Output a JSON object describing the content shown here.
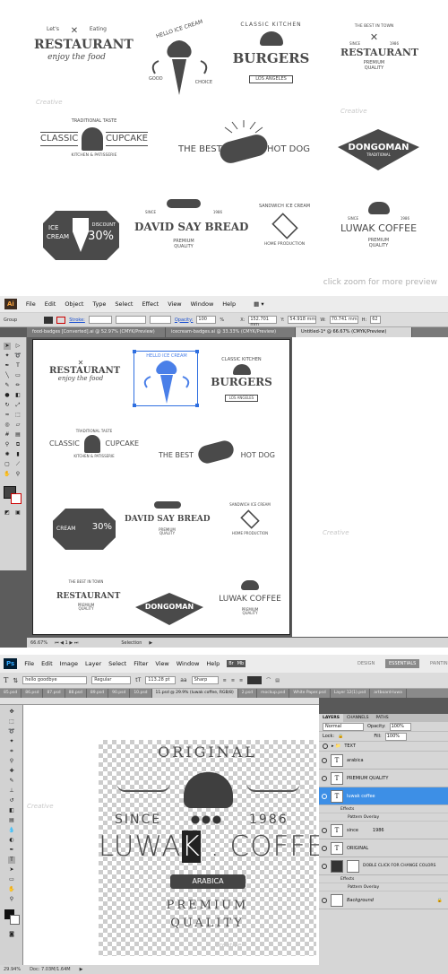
{
  "preview": {
    "caption": "click zoom for more preview",
    "badges": {
      "restaurant": {
        "top": "Let's",
        "top2": "Eating",
        "main": "RESTAURANT",
        "sub": "enjoy the food"
      },
      "icecream": {
        "arc": "HELLO ICE CREAM",
        "left": "GOOD",
        "right": "CHOICE"
      },
      "burgers": {
        "arc": "CLASSIC KITCHEN",
        "main": "BURGERS",
        "sub": "LOS ANGELES"
      },
      "restaurant2": {
        "top": "THE BEST IN TOWN",
        "since": "SINCE",
        "year": "1986",
        "main": "RESTAURANT",
        "sub1": "PREMIUM",
        "sub2": "QUALITY"
      },
      "cupcake": {
        "top": "TRADITIONAL TASTE",
        "left": "CLASSIC",
        "right": "CUPCAKE",
        "sub": "KITCHEN & PATISSERIE"
      },
      "hotdog": {
        "left": "THE BEST",
        "right": "HOT DOG"
      },
      "dongoman": {
        "main": "DONGOMAN",
        "sub": "TRADITIONAL"
      },
      "icecream2": {
        "left1": "ICE",
        "left2": "CREAM",
        "right1": "DISCOUNT",
        "right2": "30%"
      },
      "bread": {
        "since": "SINCE",
        "year": "1986",
        "main": "DAVID SAY BREAD",
        "sub1": "PREMIUM",
        "sub2": "QUALITY"
      },
      "sandwich": {
        "arc": "SANDWICH ICE CREAM",
        "sub": "HOME PRODUCTION"
      },
      "coffee": {
        "top": "ORIGINAL",
        "since": "SINCE",
        "year": "1986",
        "main": "LUWAK COFFEE",
        "sub1": "PREMIUM",
        "sub2": "QUALITY"
      }
    }
  },
  "illustrator": {
    "app_icon": "Ai",
    "menu": [
      "File",
      "Edit",
      "Object",
      "Type",
      "Select",
      "Effect",
      "View",
      "Window",
      "Help"
    ],
    "control": {
      "group": "Group",
      "stroke": "Stroke:",
      "opacity_label": "Opacity:",
      "opacity": "100",
      "pct": "%",
      "x_label": "X:",
      "x": "152.701 mm",
      "y_label": "Y:",
      "y": "54.918 mm",
      "w_label": "W:",
      "w": "70.741 mm",
      "h_label": "H:",
      "h": "62"
    },
    "tabs": [
      "food-badges [Converted].ai @ 52.97% (CMYK/Preview)",
      "icecream-badges.ai @ 33.33% (CMYK/Preview)",
      "Untitled-1* @ 66.67% (CMYK/Preview)"
    ],
    "status": {
      "zoom": "66.67%",
      "page": "1",
      "tool": "Selection"
    }
  },
  "photoshop": {
    "app_icon": "Ps",
    "menu": [
      "File",
      "Edit",
      "Image",
      "Layer",
      "Select",
      "Filter",
      "View",
      "Window",
      "Help"
    ],
    "workspaces": [
      "DESIGN",
      "ESSENTIALS",
      "PAINTIN"
    ],
    "options": {
      "font": "hello goodbye",
      "style": "Regular",
      "size": "113.28 pt",
      "aa": "Sharp"
    },
    "tabs": [
      "85.psd",
      "86.psd",
      "87.psd",
      "88.psd",
      "89.psd",
      "90.psd",
      "10.psd",
      "11.psd @ 29.9% (luwak coffee, RGB/8)",
      "2.psd",
      "mockup.psd",
      "White Paper.psd",
      "Layer 12(1).psd",
      "artboard-luwa"
    ],
    "status": {
      "zoom": "29.94%",
      "doc": "Doc: 7.03M/1.64M"
    },
    "layers_panel": {
      "tabs": [
        "LAYERS",
        "CHANNELS",
        "PATHS"
      ],
      "blend": "Normal",
      "opacity_label": "Opacity:",
      "opacity": "100%",
      "lock_label": "Lock:",
      "fill_label": "Fill:",
      "fill": "100%",
      "group": "TEXT",
      "layers": [
        {
          "name": "arabica",
          "type": "text"
        },
        {
          "name": "PREMIUM QUALITY",
          "type": "text"
        },
        {
          "name": "luwak coffee",
          "type": "text",
          "selected": true
        },
        {
          "name": "since          1986",
          "type": "text"
        },
        {
          "name": "ORIGINAL",
          "type": "text"
        },
        {
          "name": "DOBLE CLICK FOR CHANGE COLORS",
          "type": "image"
        },
        {
          "name": "Background",
          "type": "bg"
        }
      ],
      "effects": "Effects",
      "pattern": "Pattern Overlay"
    },
    "artwork": {
      "top": "ORIGINAL",
      "since": "SINCE",
      "year": "1986",
      "main_a": "LUWA",
      "main_k": "K",
      "main_b": "COFFEE",
      "banner": "ARABICA",
      "sub1": "PREMIUM",
      "sub2": "QUALITY"
    }
  },
  "watermark": "Creative"
}
